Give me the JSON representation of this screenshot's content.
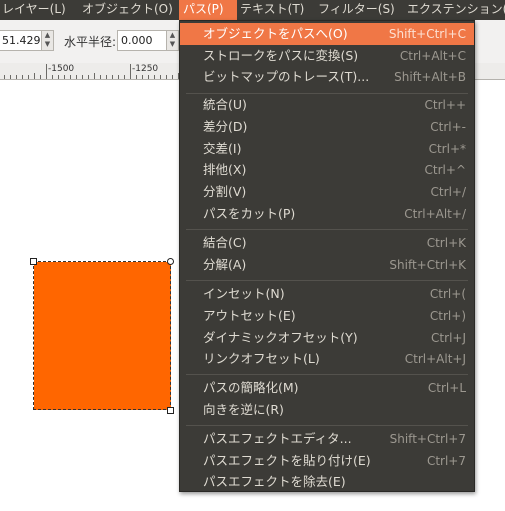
{
  "menubar": {
    "items": [
      {
        "label": "レイヤー(L)"
      },
      {
        "label": "オブジェクト(O)"
      },
      {
        "label": "パス(P)"
      },
      {
        "label": "テキスト(T)"
      },
      {
        "label": "フィルター(S)"
      },
      {
        "label": "エクステンション(N)"
      }
    ]
  },
  "toolbar": {
    "x_value": "51.429",
    "radius_label": "水平半径:",
    "radius_value": "0.000"
  },
  "ruler": {
    "labels": [
      "-1500",
      "-1250"
    ]
  },
  "path_menu": {
    "items": [
      {
        "label": "オブジェクトをパスへ(O)",
        "shortcut": "Shift+Ctrl+C"
      },
      {
        "label": "ストロークをパスに変換(S)",
        "shortcut": "Ctrl+Alt+C"
      },
      {
        "label": "ビットマップのトレース(T)...",
        "shortcut": "Shift+Alt+B"
      },
      {
        "label": "統合(U)",
        "shortcut": "Ctrl++"
      },
      {
        "label": "差分(D)",
        "shortcut": "Ctrl+-"
      },
      {
        "label": "交差(I)",
        "shortcut": "Ctrl+*"
      },
      {
        "label": "排他(X)",
        "shortcut": "Ctrl+^"
      },
      {
        "label": "分割(V)",
        "shortcut": "Ctrl+/"
      },
      {
        "label": "パスをカット(P)",
        "shortcut": "Ctrl+Alt+/"
      },
      {
        "label": "結合(C)",
        "shortcut": "Ctrl+K"
      },
      {
        "label": "分解(A)",
        "shortcut": "Shift+Ctrl+K"
      },
      {
        "label": "インセット(N)",
        "shortcut": "Ctrl+("
      },
      {
        "label": "アウトセット(E)",
        "shortcut": "Ctrl+)"
      },
      {
        "label": "ダイナミックオフセット(Y)",
        "shortcut": "Ctrl+J"
      },
      {
        "label": "リンクオフセット(L)",
        "shortcut": "Ctrl+Alt+J"
      },
      {
        "label": "パスの簡略化(M)",
        "shortcut": "Ctrl+L"
      },
      {
        "label": "向きを逆に(R)",
        "shortcut": ""
      },
      {
        "label": "パスエフェクトエディタ...",
        "shortcut": "Shift+Ctrl+7"
      },
      {
        "label": "パスエフェクトを貼り付け(E)",
        "shortcut": "Ctrl+7"
      },
      {
        "label": "パスエフェクトを除去(E)",
        "shortcut": ""
      }
    ]
  },
  "colors": {
    "menu_bg": "#3c3b37",
    "highlight": "#f07746",
    "shape_fill": "#ff6600"
  }
}
